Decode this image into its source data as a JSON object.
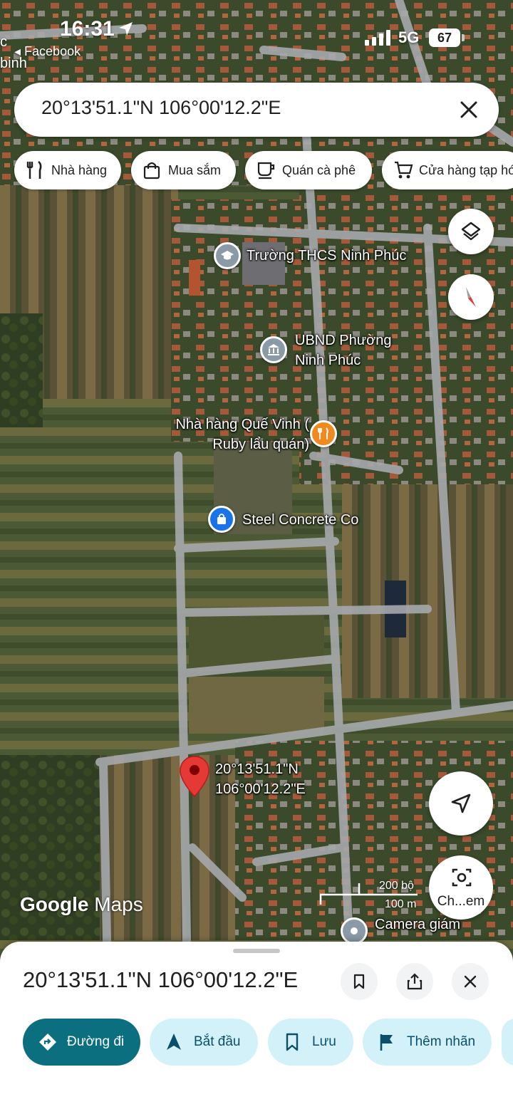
{
  "status_bar": {
    "time": "16:31",
    "back_app": "◂ Facebook",
    "edge_text_1": "c",
    "edge_text_2": "binh",
    "network": "5G",
    "battery": "67"
  },
  "search": {
    "query": "20°13'51.1\"N 106°00'12.2\"E"
  },
  "chips": [
    {
      "label": "Nhà hàng",
      "icon": "restaurant-icon"
    },
    {
      "label": "Mua sắm",
      "icon": "shopping-bag-icon"
    },
    {
      "label": "Quán cà phê",
      "icon": "coffee-icon"
    },
    {
      "label": "Cửa hàng tạp hóa",
      "icon": "cart-icon"
    }
  ],
  "map": {
    "pois": [
      {
        "name": "Trường THCS Ninh Phúc",
        "icon": "school-icon",
        "color": "#8a9aa6"
      },
      {
        "name": "UBND Phường Ninh Phúc",
        "icon": "government-icon",
        "color": "#8a9aa6"
      },
      {
        "name": "Nhà hàng Quế Vinh ( Ruby lẩu quán)",
        "icon": "restaurant-icon",
        "color": "#f08a1e"
      },
      {
        "name": "Steel Concrete Co",
        "icon": "shopping-bag-icon",
        "color": "#1a73e8"
      },
      {
        "name": "Camera giám",
        "icon": "camera-icon",
        "color": "#8a9aa6"
      }
    ],
    "pin": {
      "label_line1": "20°13'51.1\"N",
      "label_line2": "106°00'12.2\"E",
      "color": "#e53935"
    },
    "logo_google": "Google",
    "logo_maps": "Maps",
    "scale": {
      "top": "200 bộ",
      "bottom": "100 m"
    },
    "lens_label": "Ch...em"
  },
  "sheet": {
    "title": "20°13'51.1\"N 106°00'12.2\"E",
    "actions": [
      {
        "label": "Đường đi",
        "icon": "directions-icon",
        "primary": true
      },
      {
        "label": "Bắt đầu",
        "icon": "navigation-icon",
        "primary": false
      },
      {
        "label": "Lưu",
        "icon": "bookmark-icon",
        "primary": false
      },
      {
        "label": "Thêm nhãn",
        "icon": "flag-icon",
        "primary": false
      }
    ]
  },
  "colors": {
    "accent": "#0b6f7f",
    "action_bg": "#d3f1f8",
    "pin": "#e53935"
  }
}
